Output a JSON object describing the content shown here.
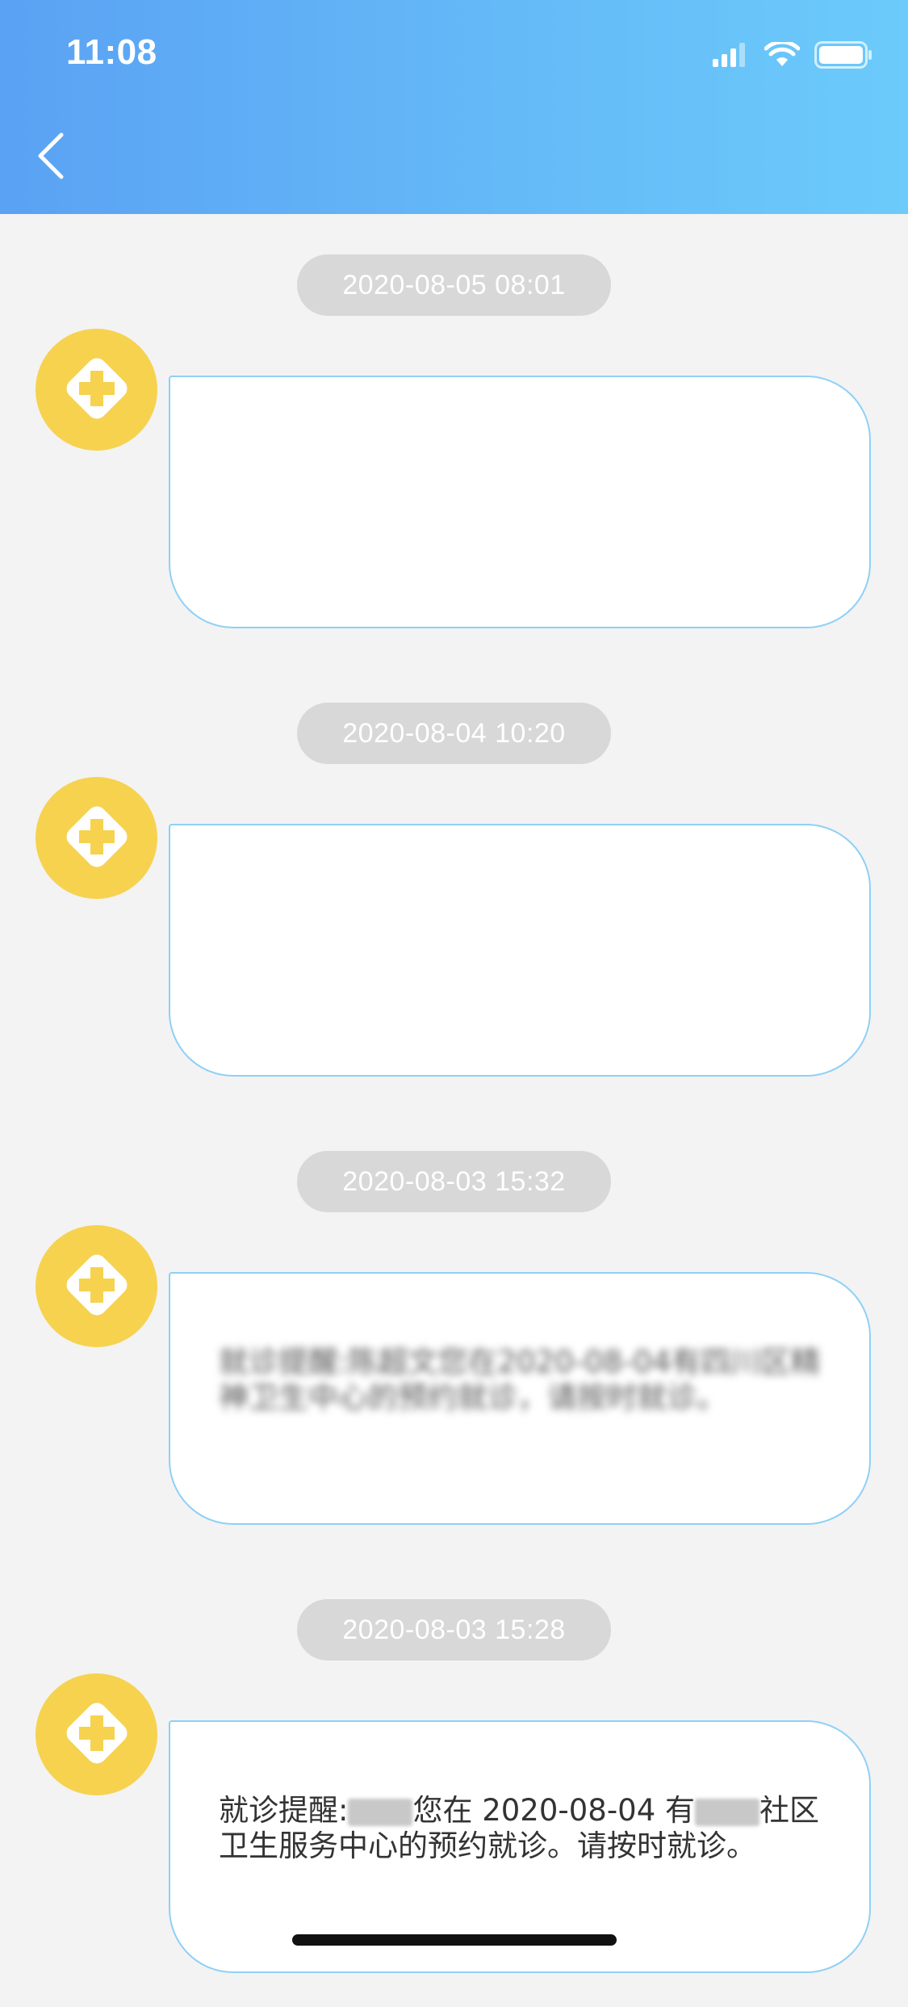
{
  "status_bar": {
    "time": "11:08"
  },
  "header": {
    "back_icon": "chevron-left-icon"
  },
  "messages": [
    {
      "timestamp": "2020-08-05 08:01",
      "text": ""
    },
    {
      "timestamp": "2020-08-04 10:20",
      "text": ""
    },
    {
      "timestamp": "2020-08-03 15:32",
      "text": "就诊提醒:陈超文您在2020-08-04有四川区精神卫生中心的预约就诊，请按时就诊。"
    },
    {
      "timestamp": "2020-08-03 15:28",
      "text_prefix": "就诊提醒:",
      "text_middle": "您在 2020-08-04 有",
      "text_suffix": "社区卫生服务中心的预约就诊。请按时就诊。"
    }
  ],
  "colors": {
    "header_start": "#5aa2f4",
    "header_end": "#6ccbfb",
    "avatar": "#f6d24f",
    "bubble_border": "#8fd0f6",
    "timestamp_pill": "#d8d8d8"
  }
}
